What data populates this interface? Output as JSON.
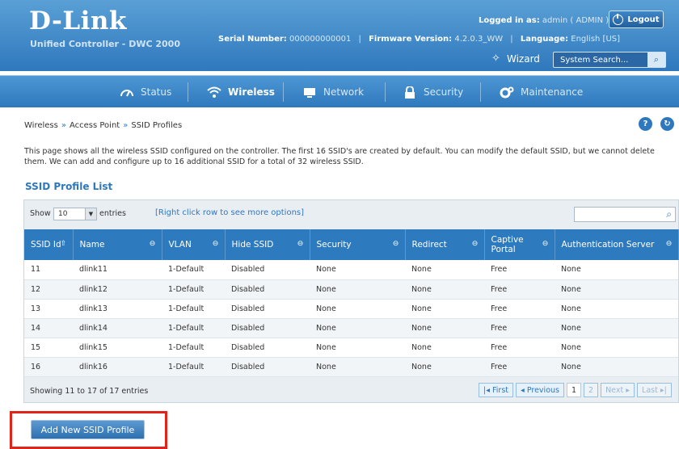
{
  "header": {
    "logo": "D-Link",
    "subtitle": "Unified Controller - DWC 2000",
    "logged_in_label": "Logged in as:",
    "logged_in_value": "admin ( ADMIN )",
    "logout_label": "Logout",
    "serial_label": "Serial Number:",
    "serial_value": "000000000001",
    "firmware_label": "Firmware Version:",
    "firmware_value": "4.2.0.3_WW",
    "language_label": "Language:",
    "language_value": "English [US]",
    "wizard_label": "Wizard",
    "search_placeholder": "System Search..."
  },
  "nav": {
    "items": [
      {
        "label": "Status",
        "icon": "dashboard-icon"
      },
      {
        "label": "Wireless",
        "icon": "wifi-icon",
        "active": true
      },
      {
        "label": "Network",
        "icon": "network-icon"
      },
      {
        "label": "Security",
        "icon": "lock-icon"
      },
      {
        "label": "Maintenance",
        "icon": "gears-icon"
      }
    ]
  },
  "breadcrumb": [
    "Wireless",
    "Access Point",
    "SSID Profiles"
  ],
  "description": "This page shows all the wireless SSID configured on the controller. The first 16 SSID's are created by default. You can modify the default SSID, but we cannot delete them. We can add and configure up to 16 additional SSID for a total of 32 wireless SSID.",
  "list_title": "SSID Profile List",
  "toolbar": {
    "show_label": "Show",
    "entries_value": "10",
    "entries_label": "entries",
    "hint": "[Right click row to see more options]"
  },
  "table": {
    "columns": [
      "SSID Id",
      "Name",
      "VLAN",
      "Hide SSID",
      "Security",
      "Redirect",
      "Captive Portal",
      "Authentication Server"
    ],
    "rows": [
      [
        "11",
        "dlink11",
        "1-Default",
        "Disabled",
        "None",
        "None",
        "Free",
        "None"
      ],
      [
        "12",
        "dlink12",
        "1-Default",
        "Disabled",
        "None",
        "None",
        "Free",
        "None"
      ],
      [
        "13",
        "dlink13",
        "1-Default",
        "Disabled",
        "None",
        "None",
        "Free",
        "None"
      ],
      [
        "14",
        "dlink14",
        "1-Default",
        "Disabled",
        "None",
        "None",
        "Free",
        "None"
      ],
      [
        "15",
        "dlink15",
        "1-Default",
        "Disabled",
        "None",
        "None",
        "Free",
        "None"
      ],
      [
        "16",
        "dlink16",
        "1-Default",
        "Disabled",
        "None",
        "None",
        "Free",
        "None"
      ]
    ]
  },
  "footer": {
    "showing": "Showing 11 to 17 of 17 entries",
    "first": "First",
    "previous": "Previous",
    "page1": "1",
    "page2": "2",
    "next": "Next",
    "last": "Last"
  },
  "add_button_label": "Add New SSID Profile",
  "colors": {
    "brand_blue": "#2e78bd",
    "highlight_red": "#e2231a"
  }
}
